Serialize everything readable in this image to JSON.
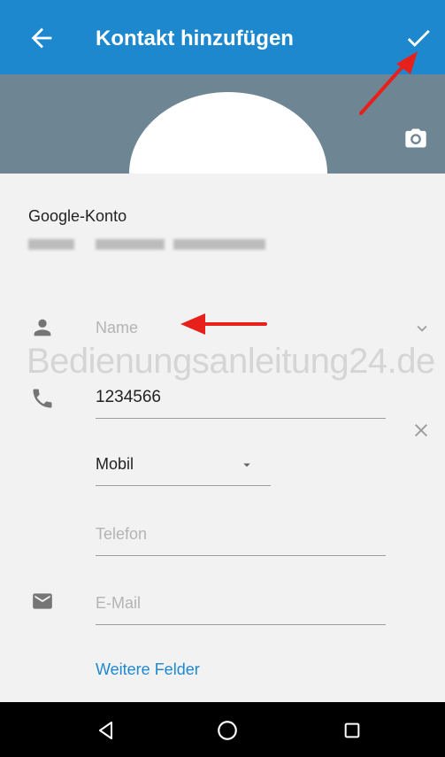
{
  "appbar": {
    "title": "Kontakt hinzufügen",
    "back_icon": "arrow-left-icon",
    "save_icon": "check-icon",
    "color": "#1e88cf"
  },
  "photo": {
    "camera_icon": "camera-icon"
  },
  "account": {
    "label": "Google-Konto"
  },
  "fields": {
    "name": {
      "placeholder": "Name",
      "icon": "person-icon"
    },
    "phone": {
      "value": "1234566",
      "icon": "phone-icon"
    },
    "phone_type": {
      "value": "Mobil"
    },
    "phone2": {
      "placeholder": "Telefon"
    },
    "email": {
      "placeholder": "E-Mail",
      "icon": "email-icon"
    }
  },
  "more_fields": "Weitere Felder",
  "watermark": "Bedienungsanleitung24.de",
  "annotation_color": "#e8201c"
}
